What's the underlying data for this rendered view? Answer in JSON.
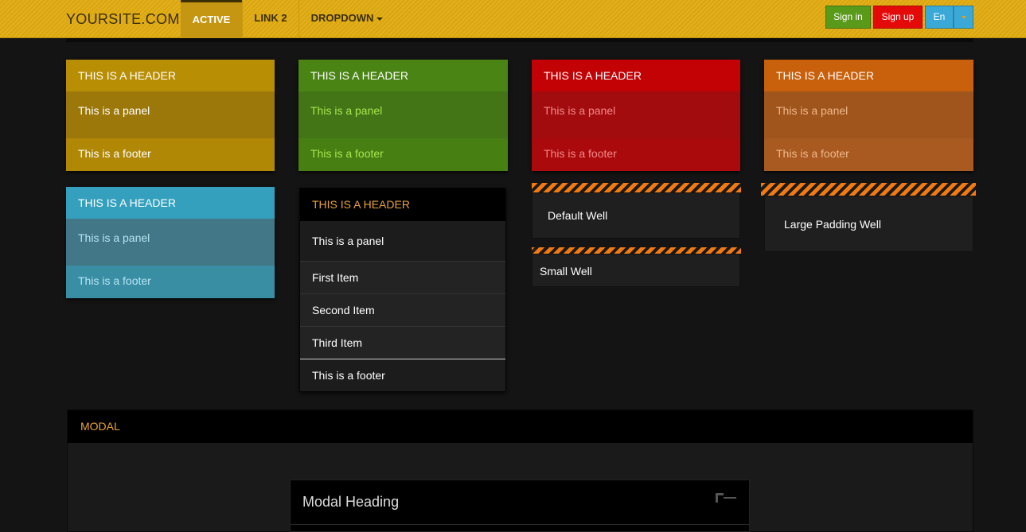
{
  "nav": {
    "brand": "YOURSITE.COM",
    "items": [
      {
        "label": "ACTIVE"
      },
      {
        "label": "LINK 2"
      },
      {
        "label": "DROPDOWN"
      }
    ],
    "signin": "Sign in",
    "signup": "Sign up",
    "lang": "En"
  },
  "panels": [
    {
      "header": "THIS IS A HEADER",
      "body": "This is a panel",
      "footer": "This is a footer",
      "color": "#b88e05"
    },
    {
      "header": "THIS IS A HEADER",
      "body": "This is a panel",
      "footer": "This is a footer",
      "color": "#4a8414"
    },
    {
      "header": "THIS IS A HEADER",
      "body": "This is a panel",
      "footer": "This is a footer",
      "color": "#c20205"
    },
    {
      "header": "THIS IS A HEADER",
      "body": "This is a panel",
      "footer": "This is a footer",
      "color": "#c8600c"
    },
    {
      "header": "THIS IS A HEADER",
      "body": "This is a panel",
      "footer": "This is a footer",
      "color": "#34a0be"
    }
  ],
  "list_panel": {
    "header": "THIS IS A HEADER",
    "body": "This is a panel",
    "items": [
      "First Item",
      "Second Item",
      "Third Item"
    ],
    "footer": "This is a footer"
  },
  "wells": {
    "default": "Default Well",
    "small": "Small Well",
    "large": "Large Padding Well"
  },
  "modal_section": {
    "header": "MODAL",
    "modal_heading": "Modal Heading"
  }
}
